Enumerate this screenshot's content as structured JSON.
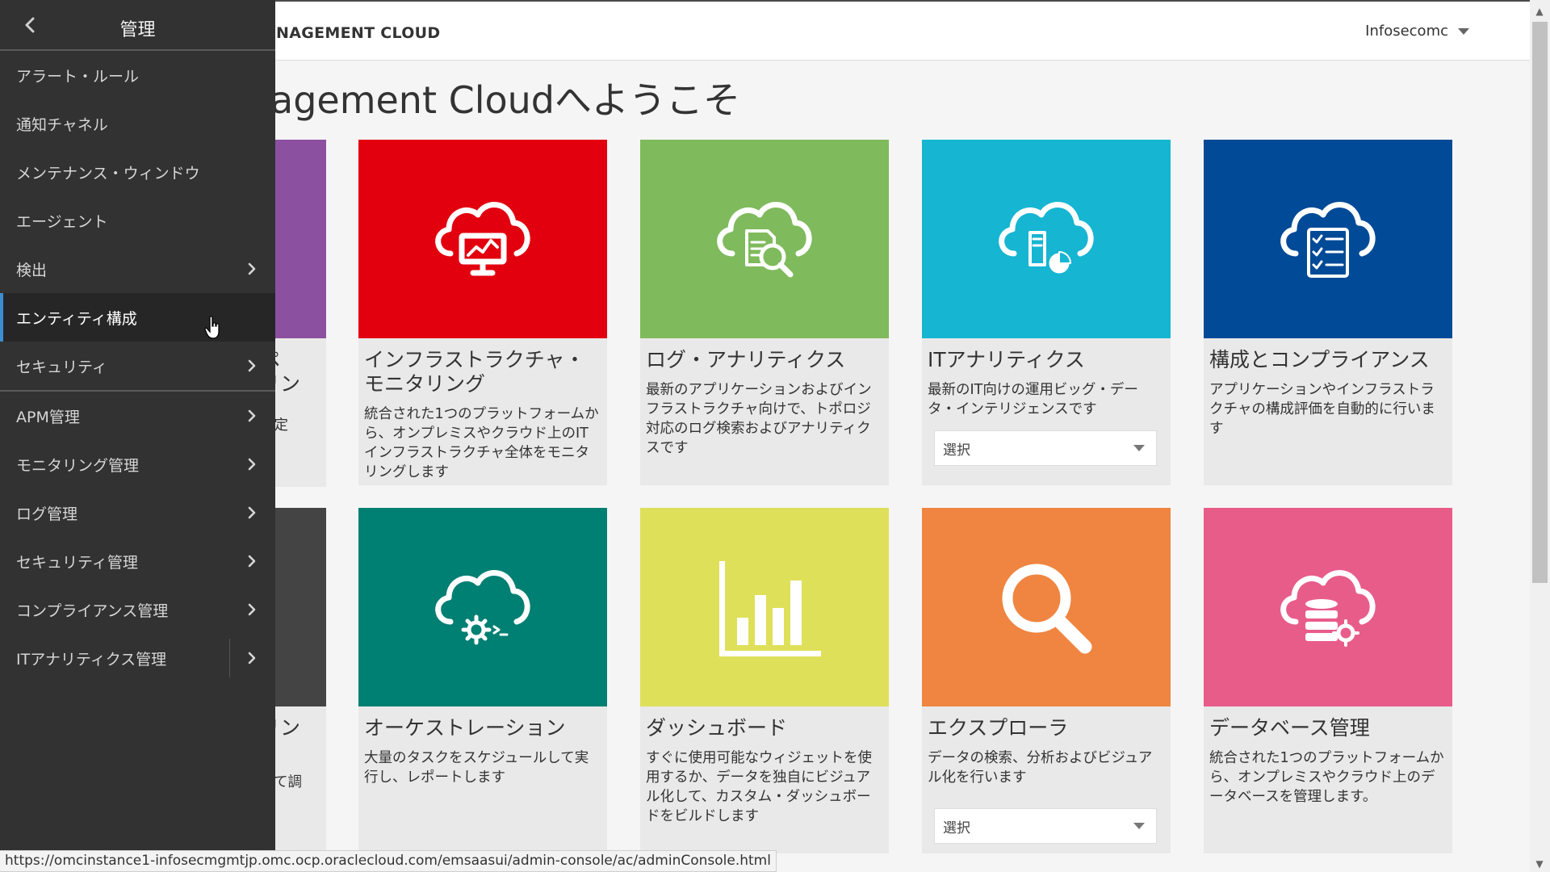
{
  "header": {
    "app_title": "NAGEMENT CLOUD",
    "user_menu": "Infosecomc",
    "welcome": "agement Cloudへようこそ"
  },
  "sidebar": {
    "title": "管理",
    "items": [
      {
        "label": "アラート・ルール",
        "has_submenu": false
      },
      {
        "label": "通知チャネル",
        "has_submenu": false
      },
      {
        "label": "メンテナンス・ウィンドウ",
        "has_submenu": false
      },
      {
        "label": "エージェント",
        "has_submenu": false
      },
      {
        "label": "検出",
        "has_submenu": true
      },
      {
        "label": "エンティティ構成",
        "has_submenu": false,
        "active": true
      },
      {
        "label": "セキュリティ",
        "has_submenu": true
      },
      {
        "label": "APM管理",
        "has_submenu": true
      },
      {
        "label": "モニタリング管理",
        "has_submenu": true
      },
      {
        "label": "ログ管理",
        "has_submenu": true
      },
      {
        "label": "セキュリティ管理",
        "has_submenu": true
      },
      {
        "label": "コンプライアンス管理",
        "has_submenu": true
      },
      {
        "label": "ITアナリティクス管理",
        "has_submenu": true
      }
    ]
  },
  "partial_cards": {
    "top_lines": [
      "ペ",
      "リン",
      "特定"
    ],
    "bottom_lines": [
      "リン",
      "して調"
    ],
    "top_color": "#8c50a0",
    "bottom_color": "#444444"
  },
  "cards_row1": [
    {
      "title": "インフラストラクチャ・モニタリング",
      "desc": "統合された1つのプラットフォームから、オンプレミスやクラウド上のITインフラストラクチャ全体をモニタリングします",
      "color": "#e2000f",
      "icon": "cloud-monitor-icon"
    },
    {
      "title": "ログ・アナリティクス",
      "desc": "最新のアプリケーションおよびインフラストラクチャ向けで、トポロジ対応のログ検索およびアナリティクスです",
      "color": "#7fba5c",
      "icon": "cloud-log-search-icon"
    },
    {
      "title": "ITアナリティクス",
      "desc": "最新のIT向けの運用ビッグ・データ・インテリジェンスです",
      "color": "#16b5d2",
      "icon": "cloud-analytics-icon",
      "select": "選択"
    },
    {
      "title": "構成とコンプライアンス",
      "desc": "アプリケーションやインフラストラクチャの構成評価を自動的に行います",
      "color": "#004a97",
      "icon": "cloud-checklist-icon"
    }
  ],
  "cards_row2": [
    {
      "title": "オーケストレーション",
      "desc": "大量のタスクをスケジュールして実行し、レポートします",
      "color": "#007f73",
      "icon": "cloud-gear-icon"
    },
    {
      "title": "ダッシュボード",
      "desc": "すぐに使用可能なウィジェットを使用するか、データを独自にビジュアル化して、カスタム・ダッシュボードをビルドします",
      "color": "#dfe05a",
      "icon": "bar-chart-icon"
    },
    {
      "title": "エクスプローラ",
      "desc": "データの検索、分析およびビジュアル化を行います",
      "color": "#ef8540",
      "icon": "magnifier-icon",
      "select": "選択"
    },
    {
      "title": "データベース管理",
      "desc": "統合された1つのプラットフォームから、オンプレミスやクラウド上のデータベースを管理します。",
      "color": "#e85c8a",
      "icon": "cloud-database-icon"
    }
  ],
  "status_url": "https://omcinstance1-infosecmgmtjp.omc.ocp.oraclecloud.com/emsaasui/admin-console/ac/adminConsole.html"
}
